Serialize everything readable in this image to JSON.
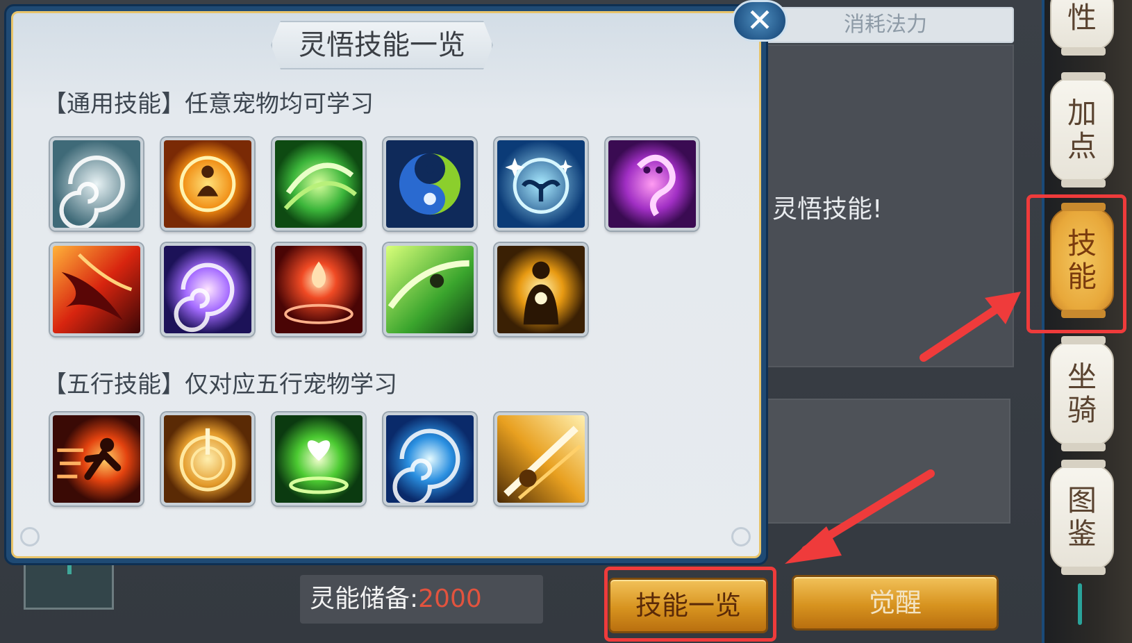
{
  "modal": {
    "title": "灵悟技能一览",
    "close_symbol": "✕",
    "general_section": "【通用技能】任意宠物均可学习",
    "element_section": "【五行技能】仅对应五行宠物学习",
    "general_icons": [
      "whirlwind-skill-icon",
      "golden-aura-skill-icon",
      "green-vortex-skill-icon",
      "yin-yang-skill-icon",
      "blue-sprout-skill-icon",
      "purple-spirit-skill-icon",
      "crimson-wing-skill-icon",
      "violet-swirl-skill-icon",
      "red-flame-skill-icon",
      "green-dash-skill-icon",
      "golden-power-skill-icon"
    ],
    "element_icons": [
      "fire-rush-skill-icon",
      "golden-rune-skill-icon",
      "green-heart-skill-icon",
      "water-whirlpool-skill-icon",
      "golden-strike-skill-icon"
    ]
  },
  "background": {
    "header": "消耗法力",
    "message": "灵悟技能!",
    "reserve_label": "灵能储备:",
    "reserve_value": "2000",
    "skills_button": "技能一览",
    "awaken_button": "觉醒"
  },
  "side_tabs": [
    {
      "label": "性"
    },
    {
      "label": "加点"
    },
    {
      "label": "技能"
    },
    {
      "label": "坐骑"
    },
    {
      "label": "图鉴"
    }
  ],
  "colors": {
    "highlight": "#ef3b3b",
    "reserve_value": "#e2533e",
    "gold_button": "#d7931f",
    "modal_border": "#e8c46a"
  }
}
